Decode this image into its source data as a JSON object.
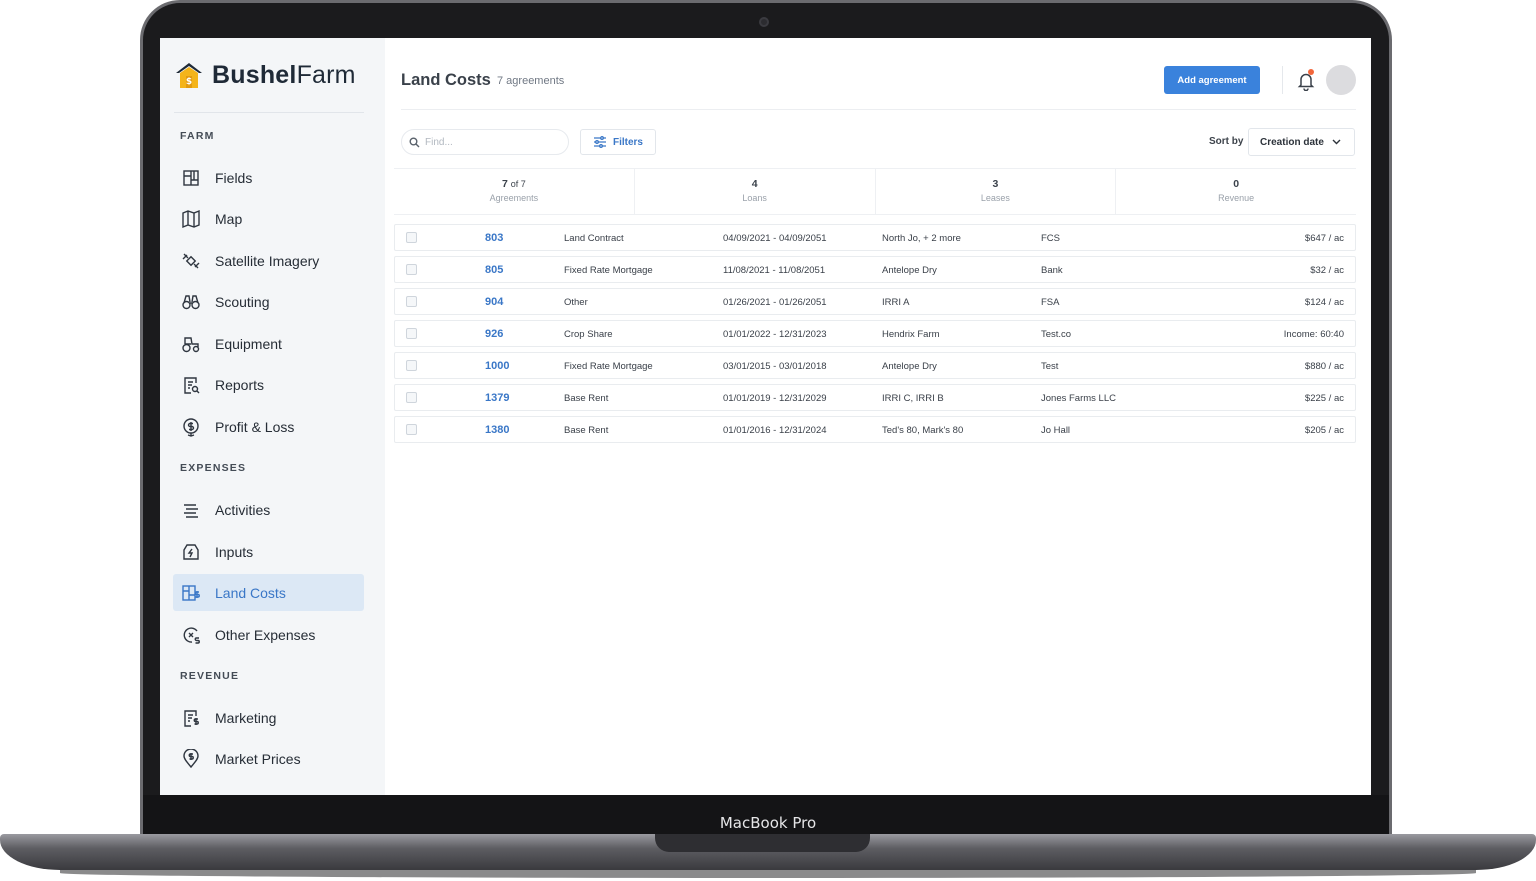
{
  "device": {
    "label": "MacBook Pro"
  },
  "brand": {
    "name_bold": "Bushel",
    "name_light": "Farm"
  },
  "sidebar": {
    "sections": [
      {
        "title": "FARM",
        "items": [
          {
            "label": "Fields",
            "icon": "fields-icon"
          },
          {
            "label": "Map",
            "icon": "map-icon"
          },
          {
            "label": "Satellite Imagery",
            "icon": "satellite-icon"
          },
          {
            "label": "Scouting",
            "icon": "binoculars-icon"
          },
          {
            "label": "Equipment",
            "icon": "tractor-icon"
          },
          {
            "label": "Reports",
            "icon": "report-icon"
          },
          {
            "label": "Profit & Loss",
            "icon": "profit-loss-icon"
          }
        ]
      },
      {
        "title": "EXPENSES",
        "items": [
          {
            "label": "Activities",
            "icon": "activities-icon"
          },
          {
            "label": "Inputs",
            "icon": "inputs-icon"
          },
          {
            "label": "Land Costs",
            "icon": "land-costs-icon",
            "active": true
          },
          {
            "label": "Other Expenses",
            "icon": "other-expenses-icon"
          }
        ]
      },
      {
        "title": "REVENUE",
        "items": [
          {
            "label": "Marketing",
            "icon": "marketing-icon"
          },
          {
            "label": "Market Prices",
            "icon": "market-prices-icon"
          }
        ]
      }
    ]
  },
  "header": {
    "title": "Land Costs",
    "count": "7 agreements",
    "add_button": "Add agreement"
  },
  "toolbar": {
    "search_placeholder": "Find...",
    "filters_label": "Filters",
    "sort_label": "Sort by",
    "sort_value": "Creation date"
  },
  "summary": [
    {
      "value": "7",
      "of": "of 7",
      "label": "Agreements"
    },
    {
      "value": "4",
      "of": "",
      "label": "Loans"
    },
    {
      "value": "3",
      "of": "",
      "label": "Leases"
    },
    {
      "value": "0",
      "of": "",
      "label": "Revenue"
    }
  ],
  "agreements": [
    {
      "id": "803",
      "type": "Land Contract",
      "dates": "04/09/2021 - 04/09/2051",
      "fields": "North Jo, + 2 more",
      "holder": "FCS",
      "cost": "$647 / ac"
    },
    {
      "id": "805",
      "type": "Fixed Rate Mortgage",
      "dates": "11/08/2021 - 11/08/2051",
      "fields": "Antelope Dry",
      "holder": "Bank",
      "cost": "$32 / ac"
    },
    {
      "id": "904",
      "type": "Other",
      "dates": "01/26/2021 - 01/26/2051",
      "fields": "IRRI A",
      "holder": "FSA",
      "cost": "$124 / ac"
    },
    {
      "id": "926",
      "type": "Crop Share",
      "dates": "01/01/2022 - 12/31/2023",
      "fields": "Hendrix Farm",
      "holder": "Test.co",
      "cost": "Income: 60:40"
    },
    {
      "id": "1000",
      "type": "Fixed Rate Mortgage",
      "dates": "03/01/2015 - 03/01/2018",
      "fields": "Antelope Dry",
      "holder": "Test",
      "cost": "$880 / ac"
    },
    {
      "id": "1379",
      "type": "Base Rent",
      "dates": "01/01/2019 - 12/31/2029",
      "fields": "IRRI C, IRRI B",
      "holder": "Jones Farms LLC",
      "cost": "$225 / ac"
    },
    {
      "id": "1380",
      "type": "Base Rent",
      "dates": "01/01/2016 - 12/31/2024",
      "fields": "Ted's 80, Mark's 80",
      "holder": "Jo Hall",
      "cost": "$205 / ac"
    }
  ]
}
